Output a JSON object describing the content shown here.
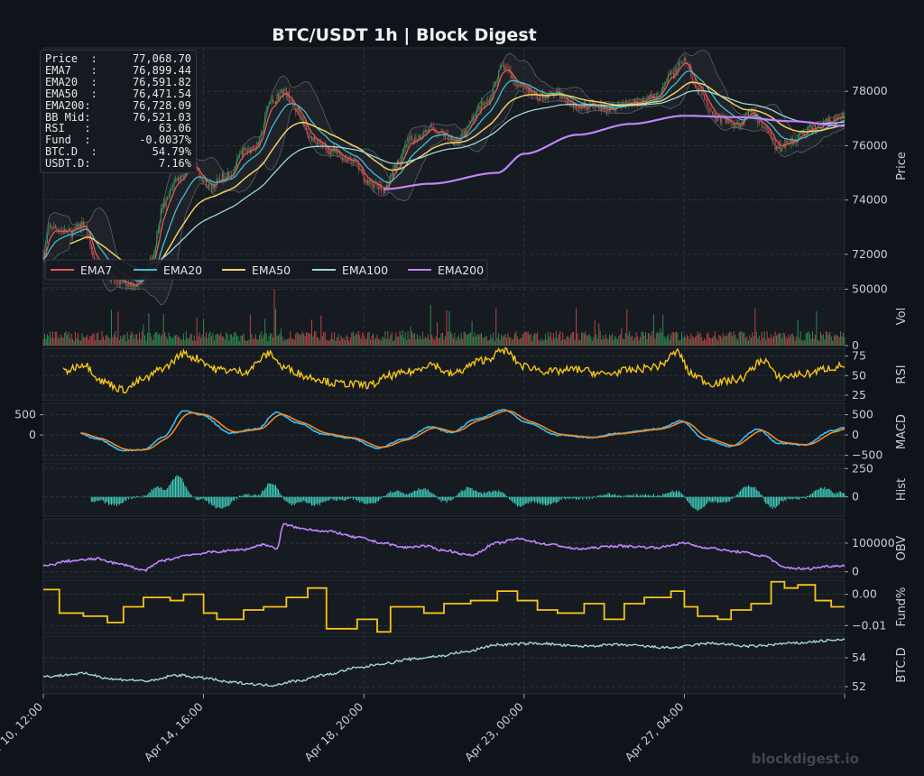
{
  "header": {
    "title": "BTC/USDT  1h  |  Block Digest"
  },
  "footer": {
    "brand": "blockdigest.io",
    "watermark": "blockdigest.io"
  },
  "info_box": [
    {
      "label": "Price  :",
      "value": "77,068.70"
    },
    {
      "label": "EMA7   :",
      "value": "76,899.44"
    },
    {
      "label": "EMA20  :",
      "value": "76,591.82"
    },
    {
      "label": "EMA50  :",
      "value": "76,471.54"
    },
    {
      "label": "EMA200:",
      "value": "76,728.09"
    },
    {
      "label": "BB Mid:",
      "value": "76,521.03"
    },
    {
      "label": "RSI   :",
      "value": "63.06"
    },
    {
      "label": "Fund  :",
      "value": "-0.0037%"
    },
    {
      "label": "BTC.D  :",
      "value": "54.79%"
    },
    {
      "label": "USDT.D:",
      "value": "7.16%"
    }
  ],
  "colors": {
    "background": "#0f131a",
    "panel": "#161a21",
    "grid": "#2d333d",
    "up": "#2e9e57",
    "down": "#d64a4a",
    "ema7": "#e05a5a",
    "ema20": "#3fbfcf",
    "ema50": "#f0d060",
    "ema100": "#a0d8d0",
    "ema200": "#c084fc",
    "rsi": "#f5c518",
    "macd": "#38bdf8",
    "signal": "#f08a24",
    "hist": "#40d0c0",
    "obv": "#c084fc",
    "fund": "#f5c518",
    "btcd": "#a0d8d0"
  },
  "chart_data": {
    "type": "line",
    "x_tick_labels": [
      "Apr 10, 12:00",
      "Apr 14, 16:00",
      "Apr 18, 20:00",
      "Apr 23, 00:00",
      "Apr 27, 04:00"
    ],
    "legend": [
      "EMA7",
      "EMA20",
      "EMA50",
      "EMA100",
      "EMA200"
    ],
    "panels": [
      {
        "id": "price",
        "ylabel": "Price",
        "yticks": [
          "72000",
          "74000",
          "76000",
          "78000"
        ],
        "ylim": [
          70900,
          79600
        ]
      },
      {
        "id": "volume",
        "ylabel": "Vol",
        "yticks": [
          "0",
          "50000"
        ],
        "ylim": [
          0,
          52000
        ]
      },
      {
        "id": "rsi",
        "ylabel": "RSI",
        "yticks": [
          "25",
          "50",
          "75"
        ],
        "ylim": [
          18,
          85
        ]
      },
      {
        "id": "macd",
        "ylabel": "MACD",
        "yticks_right": [
          "−500",
          "0",
          "500"
        ],
        "yticks_left": [
          "0",
          "500"
        ],
        "ylim": [
          -620,
          780
        ]
      },
      {
        "id": "hist",
        "ylabel": "Hist",
        "yticks": [
          "0",
          "250"
        ],
        "ylim": [
          -170,
          300
        ]
      },
      {
        "id": "obv",
        "ylabel": "OBV",
        "yticks": [
          "0",
          "100000"
        ],
        "ylim": [
          -20000,
          185000
        ]
      },
      {
        "id": "fund",
        "ylabel": "Fund%",
        "yticks": [
          "−0.01",
          "0.00"
        ],
        "ylim": [
          -0.0125,
          0.0045
        ]
      },
      {
        "id": "btcd",
        "ylabel": "BTC.D",
        "yticks": [
          "52",
          "54"
        ],
        "ylim": [
          51.5,
          55.5
        ]
      }
    ],
    "series": {
      "close_anchors": [
        [
          0,
          72000
        ],
        [
          5,
          73000
        ],
        [
          20,
          72800
        ],
        [
          30,
          73100
        ],
        [
          40,
          71600
        ],
        [
          55,
          71000
        ],
        [
          70,
          70900
        ],
        [
          80,
          71700
        ],
        [
          90,
          73800
        ],
        [
          100,
          74800
        ],
        [
          112,
          75200
        ],
        [
          125,
          74500
        ],
        [
          140,
          75000
        ],
        [
          150,
          75800
        ],
        [
          160,
          76000
        ],
        [
          170,
          77600
        ],
        [
          180,
          78000
        ],
        [
          190,
          77300
        ],
        [
          200,
          76300
        ],
        [
          215,
          75800
        ],
        [
          230,
          75500
        ],
        [
          245,
          74600
        ],
        [
          255,
          74400
        ],
        [
          265,
          75300
        ],
        [
          275,
          76200
        ],
        [
          290,
          76600
        ],
        [
          310,
          76200
        ],
        [
          330,
          77500
        ],
        [
          345,
          78900
        ],
        [
          355,
          78300
        ],
        [
          370,
          77800
        ],
        [
          385,
          77900
        ],
        [
          400,
          77500
        ],
        [
          420,
          77400
        ],
        [
          440,
          77600
        ],
        [
          460,
          77800
        ],
        [
          470,
          78600
        ],
        [
          480,
          79100
        ],
        [
          490,
          78100
        ],
        [
          505,
          77000
        ],
        [
          520,
          76800
        ],
        [
          530,
          77200
        ],
        [
          540,
          76700
        ],
        [
          550,
          75900
        ],
        [
          560,
          76200
        ],
        [
          575,
          76600
        ],
        [
          590,
          76900
        ],
        [
          600,
          77068
        ]
      ],
      "ema200_anchors": [
        [
          0,
          0
        ],
        [
          255,
          74400
        ],
        [
          290,
          74600
        ],
        [
          340,
          75000
        ],
        [
          360,
          75700
        ],
        [
          400,
          76400
        ],
        [
          440,
          76800
        ],
        [
          480,
          77100
        ],
        [
          520,
          77050
        ],
        [
          560,
          76900
        ],
        [
          600,
          76728
        ]
      ],
      "rsi_anchors": [
        [
          0,
          0
        ],
        [
          15,
          55
        ],
        [
          30,
          65
        ],
        [
          45,
          42
        ],
        [
          60,
          32
        ],
        [
          75,
          45
        ],
        [
          90,
          60
        ],
        [
          105,
          78
        ],
        [
          115,
          72
        ],
        [
          130,
          58
        ],
        [
          150,
          55
        ],
        [
          170,
          78
        ],
        [
          180,
          60
        ],
        [
          200,
          48
        ],
        [
          220,
          40
        ],
        [
          245,
          38
        ],
        [
          260,
          50
        ],
        [
          275,
          55
        ],
        [
          290,
          65
        ],
        [
          305,
          52
        ],
        [
          330,
          70
        ],
        [
          345,
          82
        ],
        [
          360,
          62
        ],
        [
          380,
          55
        ],
        [
          400,
          58
        ],
        [
          420,
          52
        ],
        [
          440,
          57
        ],
        [
          460,
          62
        ],
        [
          475,
          80
        ],
        [
          485,
          52
        ],
        [
          500,
          40
        ],
        [
          520,
          45
        ],
        [
          540,
          70
        ],
        [
          550,
          48
        ],
        [
          570,
          52
        ],
        [
          590,
          60
        ],
        [
          600,
          63
        ]
      ],
      "macd_anchors": [
        [
          0,
          -30
        ],
        [
          25,
          60
        ],
        [
          40,
          -100
        ],
        [
          60,
          -380
        ],
        [
          75,
          -360
        ],
        [
          90,
          -50
        ],
        [
          105,
          600
        ],
        [
          118,
          500
        ],
        [
          140,
          50
        ],
        [
          160,
          150
        ],
        [
          175,
          560
        ],
        [
          190,
          300
        ],
        [
          210,
          20
        ],
        [
          230,
          -80
        ],
        [
          250,
          -320
        ],
        [
          270,
          -100
        ],
        [
          290,
          200
        ],
        [
          305,
          60
        ],
        [
          325,
          400
        ],
        [
          345,
          620
        ],
        [
          362,
          300
        ],
        [
          385,
          0
        ],
        [
          410,
          -60
        ],
        [
          430,
          40
        ],
        [
          460,
          150
        ],
        [
          478,
          350
        ],
        [
          495,
          -100
        ],
        [
          515,
          -280
        ],
        [
          535,
          150
        ],
        [
          550,
          -200
        ],
        [
          570,
          -250
        ],
        [
          590,
          100
        ],
        [
          600,
          180
        ]
      ],
      "obv_anchors": [
        [
          0,
          20000
        ],
        [
          20,
          38000
        ],
        [
          40,
          45000
        ],
        [
          60,
          25000
        ],
        [
          75,
          5000
        ],
        [
          90,
          40000
        ],
        [
          110,
          60000
        ],
        [
          130,
          70000
        ],
        [
          150,
          78000
        ],
        [
          165,
          95000
        ],
        [
          175,
          82000
        ],
        [
          180,
          165000
        ],
        [
          195,
          150000
        ],
        [
          215,
          140000
        ],
        [
          235,
          120000
        ],
        [
          255,
          100000
        ],
        [
          270,
          85000
        ],
        [
          285,
          90000
        ],
        [
          300,
          75000
        ],
        [
          320,
          58000
        ],
        [
          340,
          100000
        ],
        [
          355,
          115000
        ],
        [
          380,
          95000
        ],
        [
          400,
          80000
        ],
        [
          430,
          90000
        ],
        [
          460,
          85000
        ],
        [
          480,
          100000
        ],
        [
          495,
          85000
        ],
        [
          520,
          70000
        ],
        [
          540,
          55000
        ],
        [
          555,
          15000
        ],
        [
          570,
          10000
        ],
        [
          590,
          20000
        ],
        [
          600,
          22000
        ]
      ],
      "fund_anchors": [
        [
          0,
          0.0015
        ],
        [
          12,
          -0.006
        ],
        [
          30,
          -0.007
        ],
        [
          48,
          -0.009
        ],
        [
          60,
          -0.004
        ],
        [
          75,
          -0.001
        ],
        [
          95,
          -0.002
        ],
        [
          105,
          0.0
        ],
        [
          120,
          -0.006
        ],
        [
          130,
          -0.008
        ],
        [
          150,
          -0.005
        ],
        [
          165,
          -0.004
        ],
        [
          182,
          -0.001
        ],
        [
          198,
          0.002
        ],
        [
          212,
          -0.011
        ],
        [
          235,
          -0.008
        ],
        [
          250,
          -0.012
        ],
        [
          260,
          -0.004
        ],
        [
          285,
          -0.006
        ],
        [
          300,
          -0.003
        ],
        [
          320,
          -0.002
        ],
        [
          340,
          0.001
        ],
        [
          355,
          -0.002
        ],
        [
          370,
          -0.005
        ],
        [
          385,
          -0.006
        ],
        [
          405,
          -0.003
        ],
        [
          420,
          -0.008
        ],
        [
          435,
          -0.003
        ],
        [
          450,
          -0.001
        ],
        [
          470,
          0.001
        ],
        [
          480,
          -0.004
        ],
        [
          490,
          -0.007
        ],
        [
          505,
          -0.008
        ],
        [
          515,
          -0.005
        ],
        [
          530,
          -0.003
        ],
        [
          545,
          0.004
        ],
        [
          555,
          0.002
        ],
        [
          565,
          0.003
        ],
        [
          578,
          -0.002
        ],
        [
          590,
          -0.004
        ],
        [
          600,
          -0.004
        ]
      ],
      "btcd_anchors": [
        [
          0,
          52.7
        ],
        [
          30,
          52.9
        ],
        [
          55,
          52.5
        ],
        [
          80,
          52.4
        ],
        [
          100,
          52.8
        ],
        [
          120,
          52.6
        ],
        [
          140,
          52.3
        ],
        [
          170,
          52.1
        ],
        [
          190,
          52.4
        ],
        [
          210,
          52.8
        ],
        [
          235,
          53.3
        ],
        [
          255,
          53.6
        ],
        [
          275,
          53.9
        ],
        [
          295,
          54.1
        ],
        [
          315,
          54.4
        ],
        [
          340,
          54.9
        ],
        [
          370,
          55.0
        ],
        [
          400,
          54.8
        ],
        [
          430,
          54.9
        ],
        [
          470,
          54.7
        ],
        [
          500,
          55.0
        ],
        [
          530,
          54.8
        ],
        [
          560,
          55.0
        ],
        [
          590,
          55.2
        ],
        [
          600,
          55.25
        ]
      ]
    }
  }
}
